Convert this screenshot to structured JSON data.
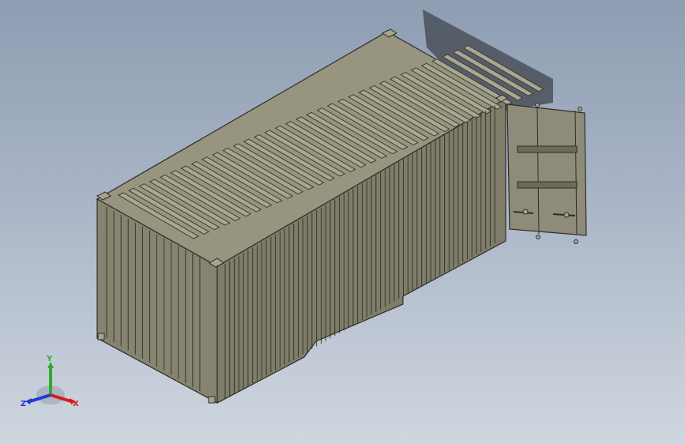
{
  "viewport": {
    "background_top": "#8e9db2",
    "background_bottom": "#cfd6df"
  },
  "model": {
    "object": "shipping-container",
    "body_color": "#8e8c78",
    "edge_color": "#2d2d27",
    "shadow_color": "#4f5560",
    "door_state": "open"
  },
  "triad": {
    "x_label": "X",
    "y_label": "Y",
    "z_label": "Z",
    "x_color": "#d21e1e",
    "y_color": "#2faa2f",
    "z_color": "#1f3ad2"
  }
}
